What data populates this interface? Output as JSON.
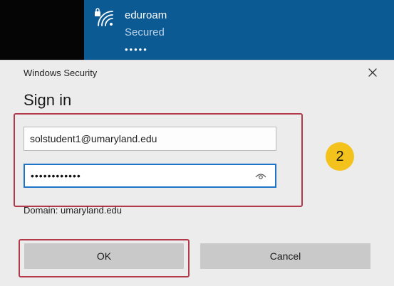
{
  "network": {
    "name": "eduroam",
    "status": "Secured",
    "dots": "•••••",
    "icon": "secured-wifi-icon"
  },
  "dialog": {
    "window_title": "Windows Security",
    "heading": "Sign in",
    "close_icon": "close-icon",
    "username_value": "solstudent1@umaryland.edu",
    "password_value": "••••••••••••",
    "password_reveal_icon": "eye-icon",
    "domain_text": "Domain: umaryland.edu",
    "ok_label": "OK",
    "cancel_label": "Cancel"
  },
  "annotation": {
    "step_number": "2",
    "highlight_color": "#b33a4b",
    "badge_color": "#f4c21c"
  },
  "colors": {
    "accent": "#1e74c6",
    "network_bar": "#0c5a94"
  }
}
